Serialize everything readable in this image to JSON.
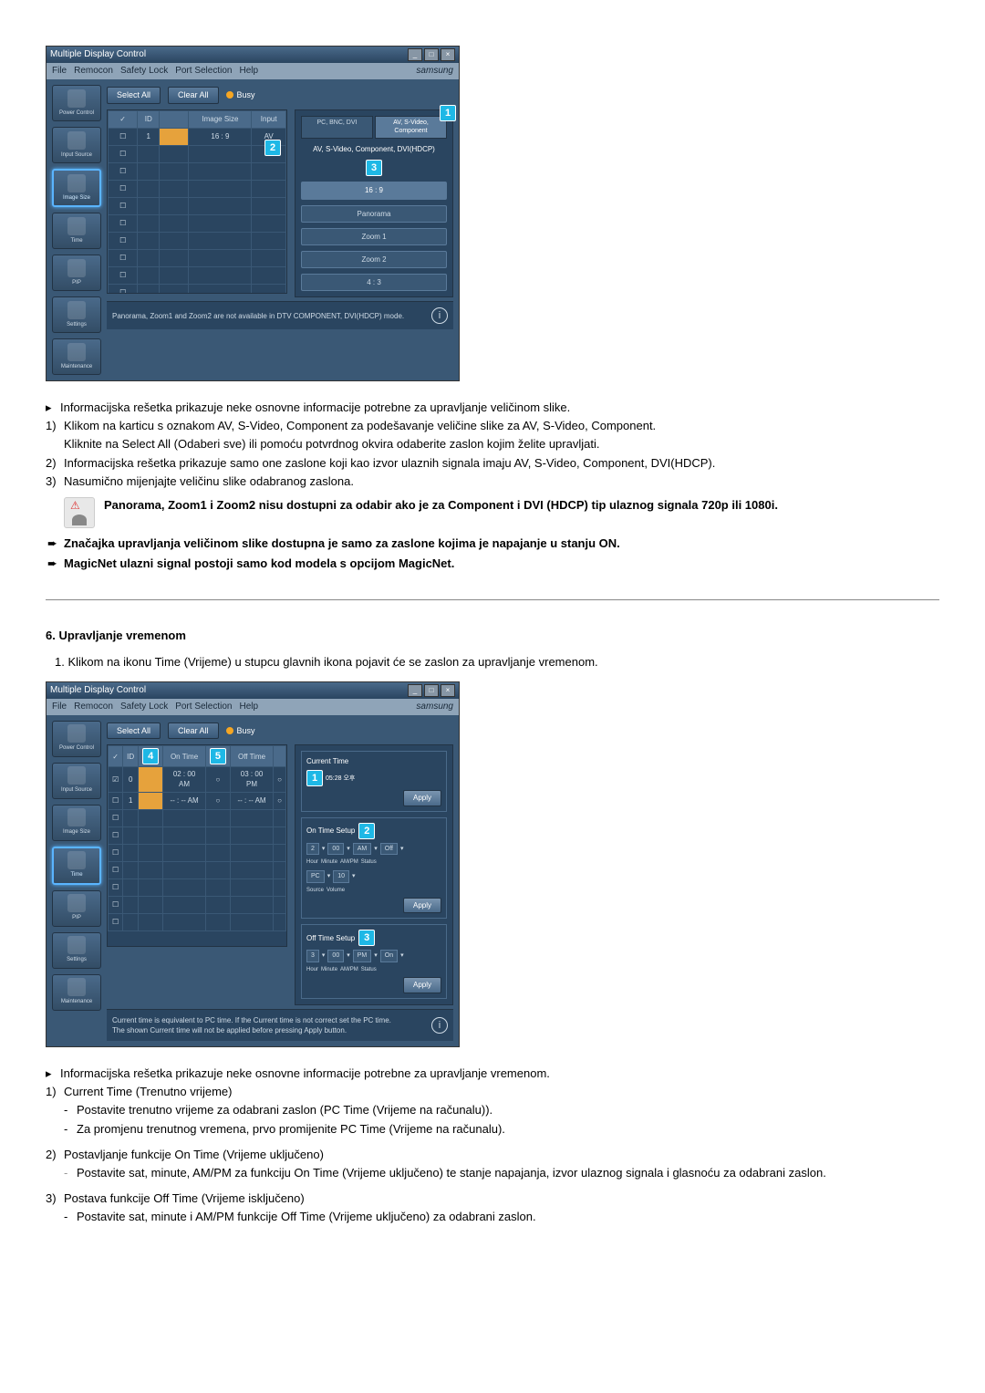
{
  "app1": {
    "title": "Multiple Display Control",
    "menubar": {
      "items": [
        "File",
        "Remocon",
        "Safety Lock",
        "Port Selection",
        "Help"
      ],
      "right": "samsung"
    },
    "topbtns": {
      "select": "Select All",
      "clear": "Clear All",
      "busy": "Busy"
    },
    "sidebar": [
      {
        "label": "Power Control"
      },
      {
        "label": "Input Source"
      },
      {
        "label": "Image Size"
      },
      {
        "label": "Time"
      },
      {
        "label": "PIP"
      },
      {
        "label": "Settings"
      },
      {
        "label": "Maintenance"
      }
    ],
    "grid_headers": [
      "",
      "ID",
      "",
      "Image Size",
      "Input"
    ],
    "grid_row1": [
      "1",
      "",
      "16 : 9",
      "AV"
    ],
    "panel_tabs": {
      "left": "PC, BNC, DVI",
      "right": "AV, S-Video, Component"
    },
    "panel_sub": "AV, S-Video, Component, DVI(HDCP)",
    "options": [
      "16 : 9",
      "Panorama",
      "Zoom 1",
      "Zoom 2",
      "4 : 3"
    ],
    "footer": "Panorama, Zoom1 and Zoom2 are not available in DTV COMPONENT, DVI(HDCP) mode.",
    "badges": {
      "b1": "1",
      "b2": "2",
      "b3": "3"
    }
  },
  "doc1": {
    "bullet1": "Informacijska rešetka prikazuje neke osnovne informacije potrebne za upravljanje veličinom slike.",
    "n1a": "Klikom na karticu s oznakom AV, S-Video, Component za podešavanje veličine slike za AV, S-Video, Component.",
    "n1b": "Kliknite na Select All (Odaberi sve) ili pomoću potvrdnog okvira odaberite zaslon kojim želite upravljati.",
    "n2": "Informacijska rešetka prikazuje samo one zaslone koji kao izvor ulaznih signala imaju AV, S-Video, Component, DVI(HDCP).",
    "n3": "Nasumično mijenjajte veličinu slike odabranog zaslona.",
    "note": "Panorama, Zoom1 i Zoom2 nisu dostupni za odabir ako je za Component i DVI (HDCP) tip ulaznog signala 720p ili 1080i.",
    "arrow1": "Značajka upravljanja veličinom slike dostupna je samo za zaslone kojima je napajanje u stanju ON.",
    "arrow2": "MagicNet ulazni signal postoji samo kod modela s opcijom MagicNet."
  },
  "section2_title": "6. Upravljanje vremenom",
  "section2_intro": "1.  Klikom na ikonu Time (Vrijeme) u stupcu glavnih ikona pojavit će se zaslon za upravljanje vremenom.",
  "app2": {
    "title": "Multiple Display Control",
    "menubar": {
      "items": [
        "File",
        "Remocon",
        "Safety Lock",
        "Port Selection",
        "Help"
      ],
      "right": "samsung"
    },
    "topbtns": {
      "select": "Select All",
      "clear": "Clear All",
      "busy": "Busy"
    },
    "sidebar": [
      {
        "label": "Power Control"
      },
      {
        "label": "Input Source"
      },
      {
        "label": "Image Size"
      },
      {
        "label": "Time"
      },
      {
        "label": "PIP"
      },
      {
        "label": "Settings"
      },
      {
        "label": "Maintenance"
      }
    ],
    "grid_headers": [
      "",
      "ID",
      "",
      "On Time",
      "",
      "Off Time",
      ""
    ],
    "grid_row1": [
      "0",
      "",
      "02 : 00  AM",
      "",
      "03 : 00  PM",
      ""
    ],
    "grid_row2": [
      "1",
      "",
      "-- : --   AM",
      "",
      "-- : --   AM",
      ""
    ],
    "current_time_title": "Current Time",
    "current_time_value": "05:28 오후",
    "ontime_title": "On Time Setup",
    "ontime_labels": {
      "hour": "Hour",
      "minute": "Minute",
      "ampm": "AM/PM",
      "status": "Status",
      "source": "Source",
      "volume": "Volume"
    },
    "ontime_values": {
      "hour": "2",
      "minute": "00",
      "ampm": "AM",
      "status": "Off",
      "source": "PC",
      "volume": "10"
    },
    "offtime_title": "Off Time Setup",
    "offtime_values": {
      "hour": "3",
      "minute": "00",
      "ampm": "PM",
      "status": "On"
    },
    "apply": "Apply",
    "footer1": "Current time is equivalent to PC time. If the Current time is not correct set the PC time.",
    "footer2": "The shown Current time will not be applied before pressing Apply button.",
    "badges": {
      "b1": "1",
      "b2": "2",
      "b3": "3",
      "b4": "4",
      "b5": "5"
    }
  },
  "doc2": {
    "bullet1": "Informacijska rešetka prikazuje neke osnovne informacije potrebne za upravljanje vremenom.",
    "n1": "Current Time (Trenutno vrijeme)",
    "n1a": "Postavite trenutno vrijeme za odabrani zaslon (PC Time (Vrijeme na računalu)).",
    "n1b": "Za promjenu trenutnog vremena, prvo promijenite PC Time (Vrijeme na računalu).",
    "n2": "Postavljanje funkcije On Time (Vrijeme uključeno)",
    "n2a": "Postavite sat, minute, AM/PM za funkciju On Time (Vrijeme uključeno) te stanje napajanja, izvor ulaznog signala i glasnoću za odabrani zaslon.",
    "n3": "Postava funkcije Off Time (Vrijeme isključeno)",
    "n3a": "Postavite sat, minute i AM/PM funkcije Off Time (Vrijeme uključeno) za odabrani zaslon."
  },
  "labels": {
    "num1": "1)",
    "num2": "2)",
    "num3": "3)",
    "bullet": "▸",
    "arrow": "➨",
    "dash": "-"
  }
}
